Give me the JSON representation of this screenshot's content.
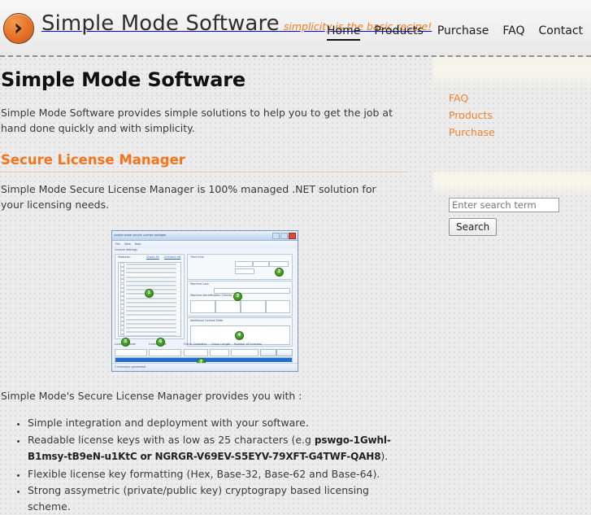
{
  "header": {
    "logo_icon": "orange-circle-chevron-right-icon",
    "brand_name": "Simple Mode Software",
    "tagline": "simplicity is the basic recipe!",
    "nav": [
      {
        "label": "Home",
        "active": true
      },
      {
        "label": "Products",
        "active": false
      },
      {
        "label": "Purchase",
        "active": false
      },
      {
        "label": "FAQ",
        "active": false
      },
      {
        "label": "Contact",
        "active": false
      }
    ]
  },
  "content": {
    "page_title": "Simple Mode Software",
    "intro_paragraph": "Simple Mode Software provides simple solutions to help you to get the job at hand done quickly and with simplicity.",
    "section_heading": "Secure License Manager",
    "section_paragraph": "Simple Mode Secure License Manager is 100% managed .NET solution for your licensing needs.",
    "lead_paragraph": "Simple Mode's Secure License Manager provides you with :",
    "features": [
      {
        "text_before": "Simple integration and deployment with your software.",
        "code1": "",
        "text_middle": "",
        "code2": "",
        "text_after": ""
      },
      {
        "text_before": "Readable license keys with as low as 25 characters (e.g ",
        "code1": "pswgo-1Gwhl-B1msy-tB9eN-u1KtC",
        "text_middle": "  or  ",
        "code2": "NGRGR-V69EV-S5EYV-79XFT-G4TWF-QAH8",
        "text_after": ")."
      },
      {
        "text_before": "Flexible license key formatting (Hex, Base-32, Base-62 and Base-64).",
        "code1": "",
        "text_middle": "",
        "code2": "",
        "text_after": ""
      },
      {
        "text_before": "Strong assymetric (private/public key) cryptograpy based licensing scheme.",
        "code1": "",
        "text_middle": "",
        "code2": "",
        "text_after": ""
      }
    ]
  },
  "screenshot": {
    "window_title": "Simple Mode Secure License Manager",
    "menu": [
      "File",
      "View",
      "Help"
    ],
    "status_text": "3 license(s) generated",
    "group_titles": {
      "license_settings": "License Settings",
      "features": "Features:",
      "time_limit": "Time limit",
      "machine_lock": "Machine Lock",
      "machine_identification": "Machine Identification Criteria",
      "additional_data": "Additional License Data"
    },
    "links": [
      "Check All",
      "UnCheck All"
    ],
    "bottom_labels": [
      "License Format",
      "License Type",
      "Group Separator",
      "Group Length",
      "Number of Licenses"
    ],
    "buttons": [
      "Generate",
      "Validate"
    ],
    "annotations": [
      "1",
      "2",
      "3",
      "4",
      "5",
      "6",
      "7"
    ]
  },
  "sidebar": {
    "nav_items": [
      {
        "label": "FAQ"
      },
      {
        "label": "Products"
      },
      {
        "label": "Purchase"
      }
    ],
    "search": {
      "placeholder": "Enter search term",
      "value": "",
      "button_label": "Search"
    }
  },
  "colors": {
    "accent_orange": "#F3741B",
    "link_orange": "#F0822F",
    "page_bg": "#ECECEC",
    "panel_cream": "#F5F4E7",
    "badge_green": "#3F9A22"
  }
}
